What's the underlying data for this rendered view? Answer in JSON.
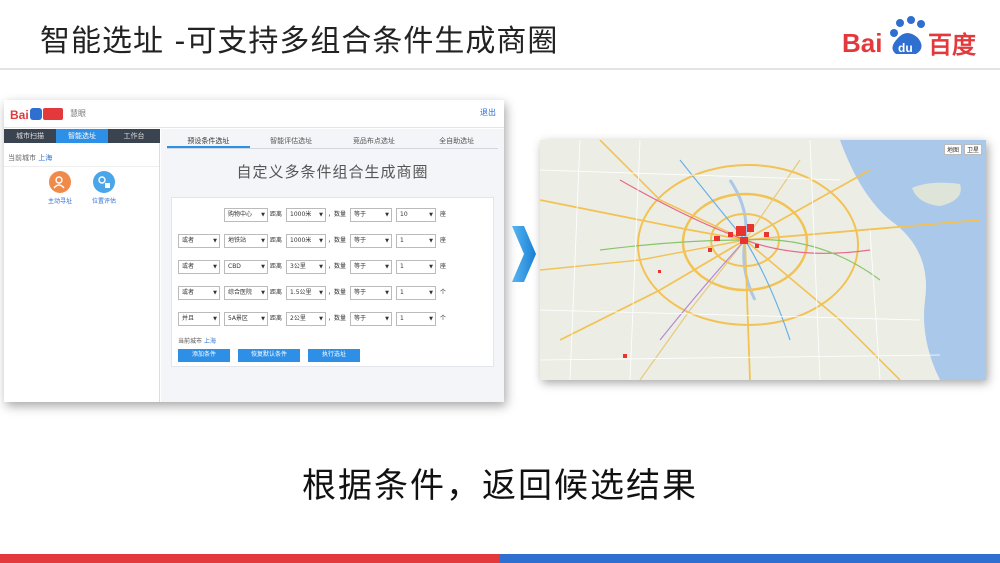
{
  "slide": {
    "title": "智能选址 -可支持多组合条件生成商圈",
    "caption": "根据条件，返回候选结果"
  },
  "brand": {
    "name": "百度"
  },
  "colors": {
    "baidu_red": "#e4393c",
    "baidu_blue": "#2e6fd0",
    "accent": "#2e8fe6"
  },
  "app": {
    "module_name": "慧眼",
    "logout": "退出",
    "left_tabs": [
      "城市扫描",
      "智能选址",
      "工作台"
    ],
    "current_city_label": "当前城市",
    "current_city": "上海",
    "tools": [
      {
        "label": "主动寻址",
        "icon": "user-search-icon"
      },
      {
        "label": "位置评估",
        "icon": "location-eval-icon"
      }
    ],
    "sub_tabs": [
      "预设条件选址",
      "智能评估选址",
      "竞品布点选址",
      "全自助选址"
    ],
    "panel_title": "自定义多条件组合生成商圈",
    "rows": [
      {
        "logic": "",
        "poi": "购物中心",
        "dist_label": "距离",
        "dist": "1000米",
        "count_label": "，数量",
        "op": "等于",
        "num": "10",
        "unit": "座"
      },
      {
        "logic": "或者",
        "poi": "地铁站",
        "dist_label": "距离",
        "dist": "1000米",
        "count_label": "，数量",
        "op": "等于",
        "num": "1",
        "unit": "座"
      },
      {
        "logic": "或者",
        "poi": "CBD",
        "dist_label": "距离",
        "dist": "3公里",
        "count_label": "，数量",
        "op": "等于",
        "num": "1",
        "unit": "座"
      },
      {
        "logic": "或者",
        "poi": "综合医院",
        "dist_label": "距离",
        "dist": "1.5公里",
        "count_label": "，数量",
        "op": "等于",
        "num": "1",
        "unit": "个"
      },
      {
        "logic": "并且",
        "poi": "5A景区",
        "dist_label": "距离",
        "dist": "2公里",
        "count_label": "，数量",
        "op": "等于",
        "num": "1",
        "unit": "个"
      }
    ],
    "form_city_label": "当前城市",
    "form_city": "上海",
    "buttons": {
      "add": "添加条件",
      "reset": "恢复默认条件",
      "run": "执行选址"
    }
  },
  "map": {
    "controls": [
      "地图",
      "卫星"
    ]
  }
}
